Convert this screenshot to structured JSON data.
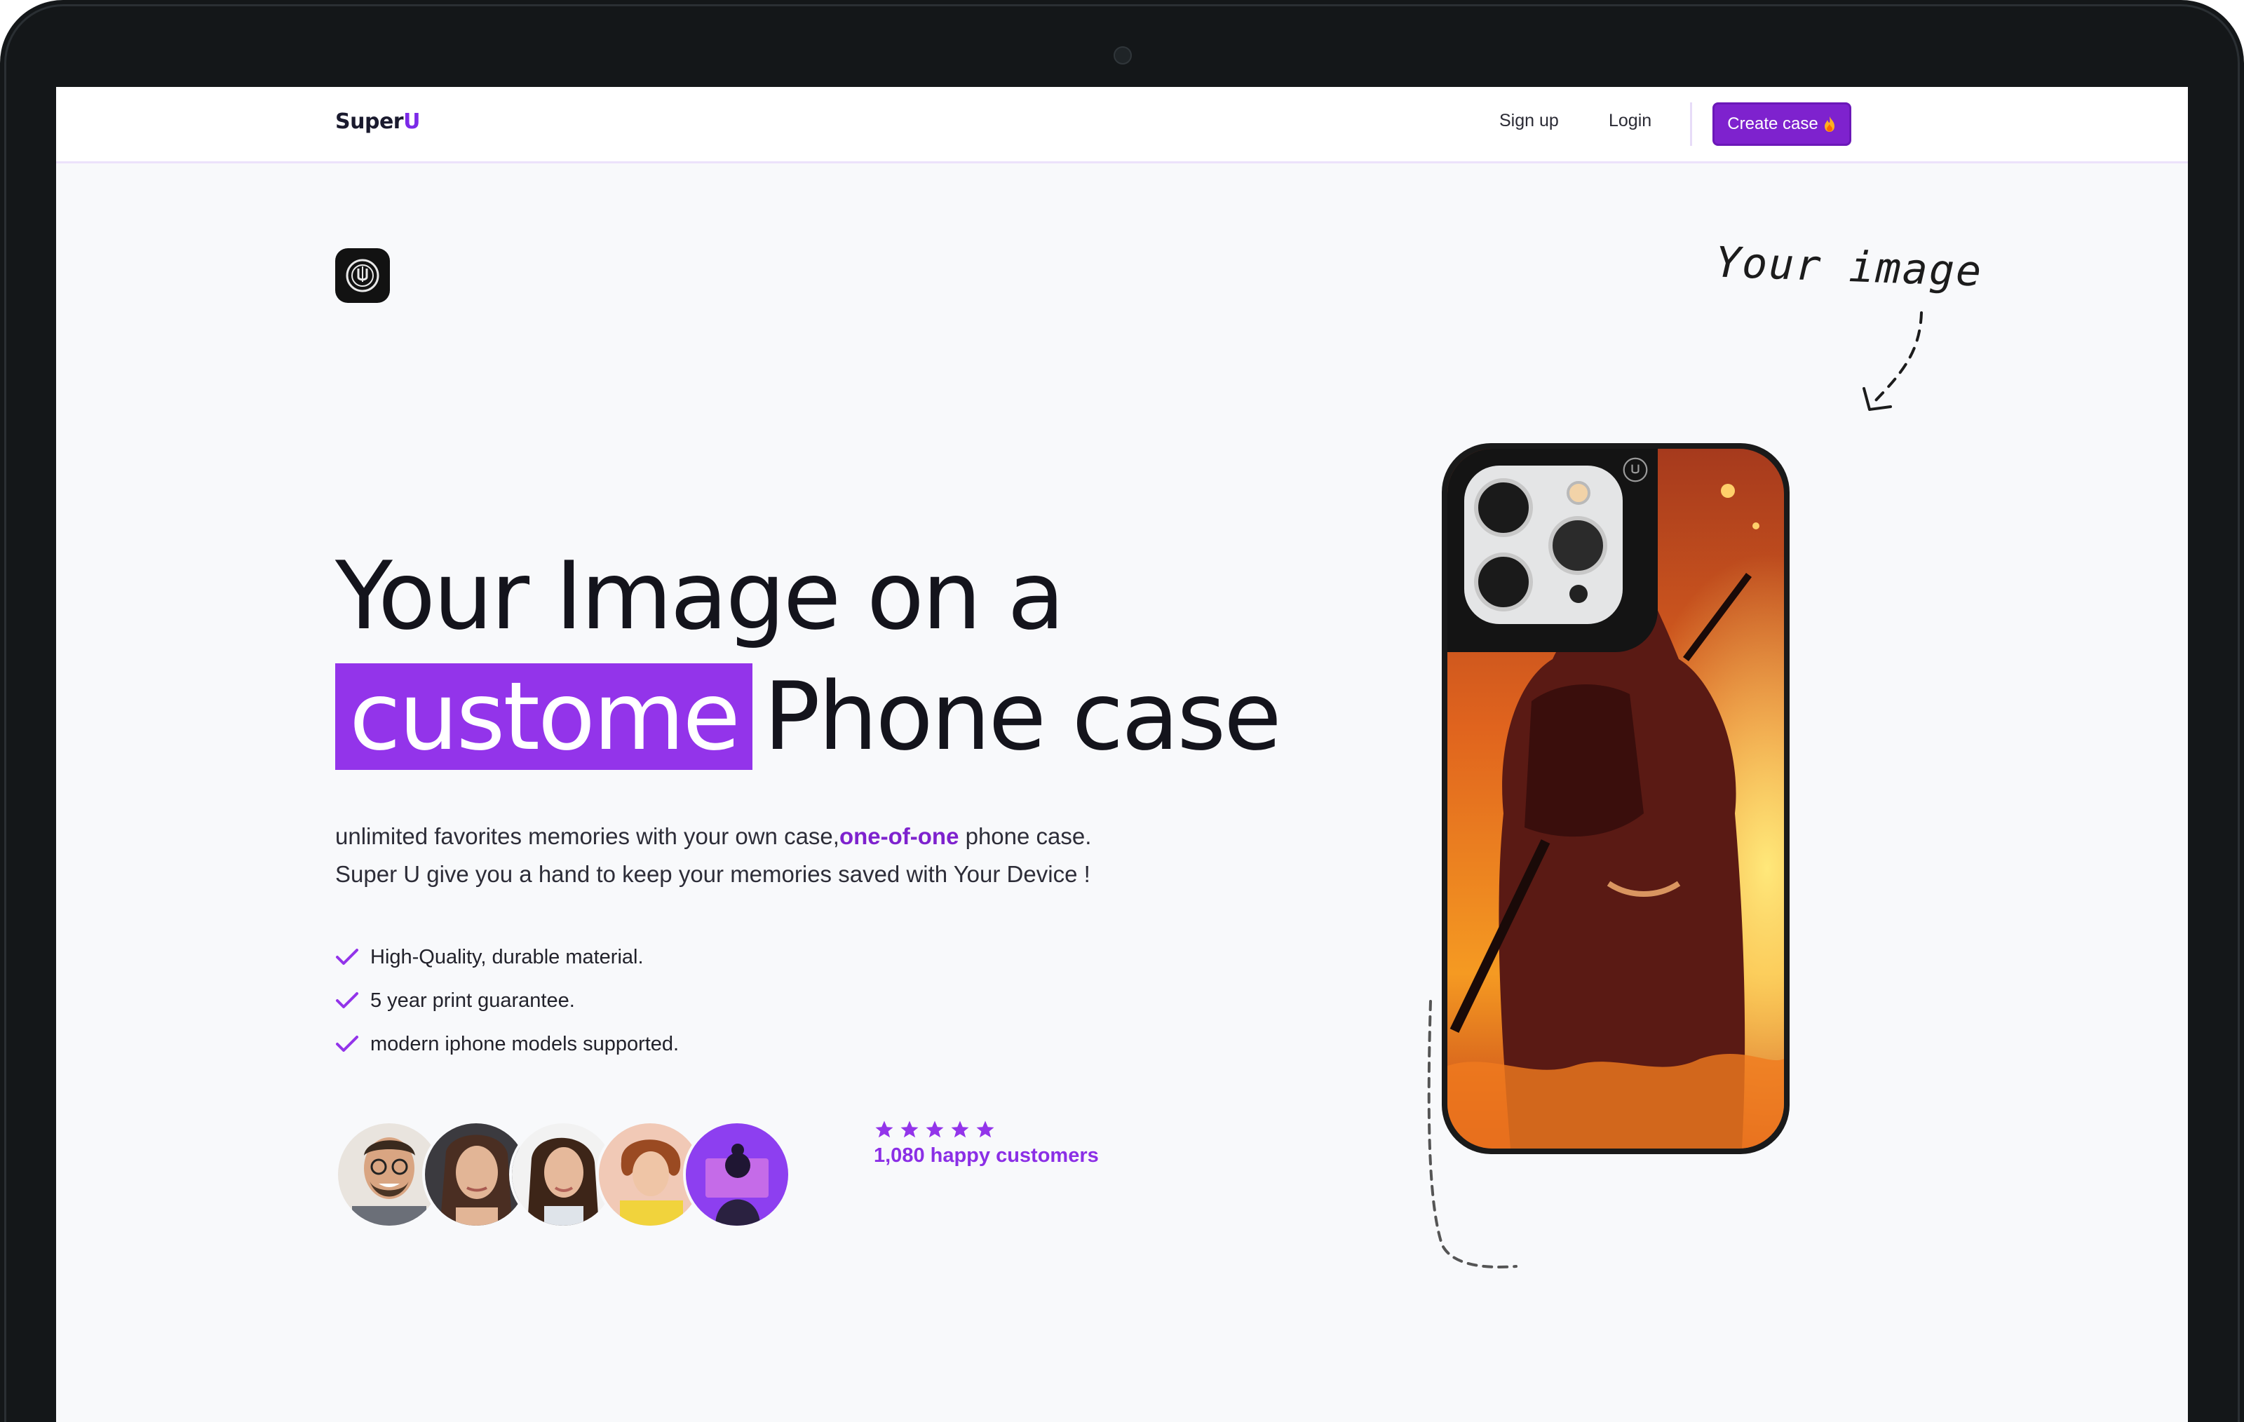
{
  "nav": {
    "logo_prefix": "Super",
    "logo_suffix": "U",
    "signup_label": "Sign up",
    "login_label": "Login",
    "cta_label": "Create case"
  },
  "hero": {
    "headline_line1": "Your Image on a",
    "headline_highlight": "custome",
    "headline_line2_rest": "Phone case",
    "sub_text_1": "unlimited favorites memories with your own case,",
    "sub_accent": "one-of-one",
    "sub_text_2": " phone case.",
    "sub_line2": "Super U give you a hand to keep your memories saved with Your Device !",
    "features": [
      "High-Quality, durable material.",
      "5 year print guarantee.",
      "modern iphone models supported."
    ],
    "rating_stars": 5,
    "happy_customers": "1,080 happy customers"
  },
  "showcase": {
    "annotation": "Your image"
  },
  "colors": {
    "accent": "#9334ea",
    "accent_dark": "#7e22ce"
  }
}
